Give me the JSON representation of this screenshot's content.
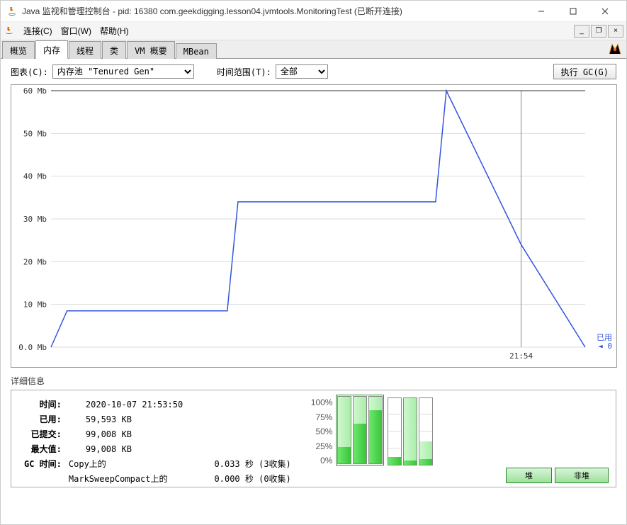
{
  "window": {
    "title": "Java 监视和管理控制台 - pid: 16380 com.geekdigging.lesson04.jvmtools.MonitoringTest (已断开连接)"
  },
  "menu": {
    "connect": "连接(C)",
    "window": "窗口(W)",
    "help": "帮助(H)"
  },
  "tabs": {
    "overview": "概览",
    "memory": "内存",
    "threads": "线程",
    "classes": "类",
    "vm": "VM 概要",
    "mbean": "MBean"
  },
  "controls": {
    "chart_label": "图表(C):",
    "chart_value": "内存池 \"Tenured Gen\"",
    "time_label": "时间范围(T):",
    "time_value": "全部",
    "gc_button": "执行 GC(G)"
  },
  "chart_data": {
    "type": "line",
    "ylabel": "Mb",
    "ylim": [
      0,
      60
    ],
    "yticks": [
      "0.0 Mb",
      "10 Mb",
      "20 Mb",
      "30 Mb",
      "40 Mb",
      "50 Mb",
      "60 Mb"
    ],
    "xtick_label": "21:54",
    "annotation": {
      "label": "已用",
      "value": "0"
    },
    "x": [
      0,
      0.03,
      0.33,
      0.35,
      0.67,
      0.72,
      0.74,
      0.88,
      1.0
    ],
    "y": [
      0.0,
      8.5,
      8.5,
      34,
      34,
      34,
      60,
      24,
      0.0
    ],
    "marker_x": 0.88
  },
  "details": {
    "title": "详细信息",
    "time_label": "时间:",
    "time_value": "2020-10-07 21:53:50",
    "used_label": "已用:",
    "used_value": "59,593 KB",
    "committed_label": "已提交:",
    "committed_value": "99,008 KB",
    "max_label": "最大值:",
    "max_value": "99,008 KB",
    "gc_label": "GC 时间:",
    "gc_copy": "Copy上的",
    "gc_copy_time": "0.033 秒 (3收集)",
    "gc_msc": "MarkSweepCompact上的",
    "gc_msc_time": "0.000 秒 (0收集)"
  },
  "bars": {
    "scale": [
      "100%",
      "75%",
      "50%",
      "25%",
      "0%"
    ],
    "heap_label": "堆",
    "nonheap_label": "非堆",
    "heap": [
      {
        "fill": 100,
        "used": 25
      },
      {
        "fill": 100,
        "used": 60
      },
      {
        "fill": 100,
        "used": 80
      }
    ],
    "nonheap": [
      {
        "fill": 12,
        "used": 12
      },
      {
        "fill": 100,
        "used": 6
      },
      {
        "fill": 35,
        "used": 8
      }
    ]
  }
}
